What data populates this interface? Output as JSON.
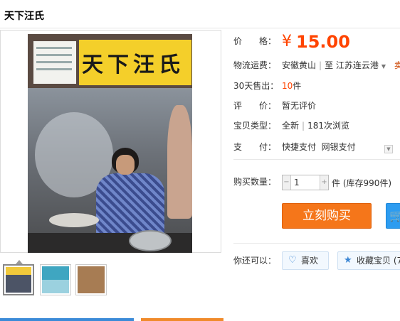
{
  "title": "天下汪氏",
  "gallery": {
    "cover_title": "天下汪氏",
    "thumbnails": [
      "cover-front",
      "cover-blue",
      "cover-brown"
    ]
  },
  "info": {
    "price_label": "价　　格：",
    "price_symbol": "¥",
    "price_value": "15.00",
    "shipping_label": "物流运费：",
    "shipping_from": "安徽黄山",
    "shipping_to_prefix": "至",
    "shipping_to": "江苏连云港",
    "shipping_cut": "卖",
    "sold_label": "30天售出：",
    "sold_count": "10",
    "sold_unit": "件",
    "review_label": "评　　价：",
    "review_value": "暂无评价",
    "type_label": "宝贝类型：",
    "type_value": "全新",
    "views": "181次浏览",
    "pay_label": "支　　付：",
    "pay_quick": "快捷支付",
    "pay_bank": "网银支付",
    "qty_label": "购买数量：",
    "qty_value": "1",
    "qty_unit": "件 (库存990件)",
    "buy_label": "立刻购买",
    "also_label": "你还可以：",
    "like_label": "喜欢",
    "fav_label": "收藏宝贝 (7"
  },
  "colors": {
    "price": "#ff4400",
    "buy_button": "#f5761a",
    "cart_button": "#2d9cf0"
  }
}
